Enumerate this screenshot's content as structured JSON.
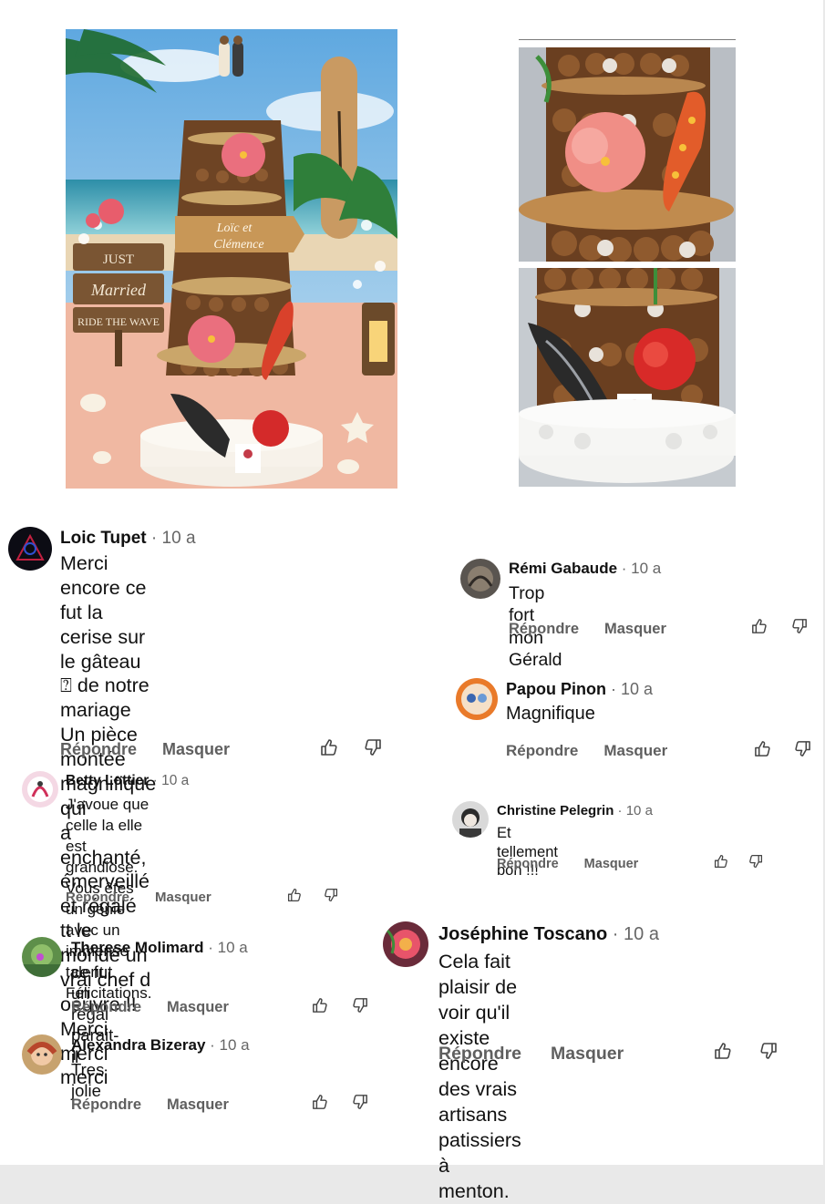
{
  "comments": [
    {
      "name": "Loic Tupet",
      "time": "10 a",
      "lines": [
        "Merci encore ce fut la cerise sur",
        "le gâteau ⍰ de notre mariage",
        "Un pièce montée magnifique qui",
        "a enchanté, émerveillé et régalé",
        "tt le monde un vrai chef d",
        "oeuvre !!",
        "Merci merci merci"
      ],
      "reply": "Répondre",
      "hide": "Masquer"
    },
    {
      "name": "Rémi Gabaude",
      "time": "10 a",
      "lines": [
        "Trop fort mon Gérald"
      ],
      "reply": "Répondre",
      "hide": "Masquer"
    },
    {
      "name": "Papou Pinon",
      "time": "10 a",
      "lines": [
        "Magnifique"
      ],
      "reply": "Répondre",
      "hide": "Masquer"
    },
    {
      "name": "Betty Lottier",
      "time": "10 a",
      "lines": [
        "J'avoue que celle la elle est",
        "grandiose. Vous êtes un génie",
        "avec un immense talent.",
        "Félicitations."
      ],
      "reply": "Répondre",
      "hide": "Masquer"
    },
    {
      "name": "Christine Pelegrin",
      "time": "10 a",
      "lines": [
        "Et tellement bon !!!"
      ],
      "reply": "Répondre",
      "hide": "Masquer"
    },
    {
      "name": "Joséphine Toscano",
      "time": "10 a",
      "lines": [
        "Cela fait plaisir de voir qu'il existe",
        "encore des vrais artisans",
        "patissiers à menton."
      ],
      "reply": "Répondre",
      "hide": "Masquer"
    },
    {
      "name": "Therese Molimard",
      "time": "10 a",
      "lines": [
        "ce fut un régal parait-il"
      ],
      "reply": "Répondre",
      "hide": "Masquer"
    },
    {
      "name": "Alexandra Bizeray",
      "time": "10 a",
      "lines": [
        "Tres jolie"
      ],
      "reply": "Répondre",
      "hide": "Masquer"
    }
  ],
  "photos": {
    "sign_lines": [
      "JUST",
      "Married",
      "RIDE THE WAVE"
    ],
    "topper_text": [
      "Loïc et",
      "Clémence"
    ]
  },
  "icons": {
    "like": "thumbs-up-icon",
    "dislike": "thumbs-down-icon"
  },
  "colors": {
    "action_gray": "#5f5f5f",
    "timestamp_gray": "#666666",
    "text": "#111111"
  }
}
